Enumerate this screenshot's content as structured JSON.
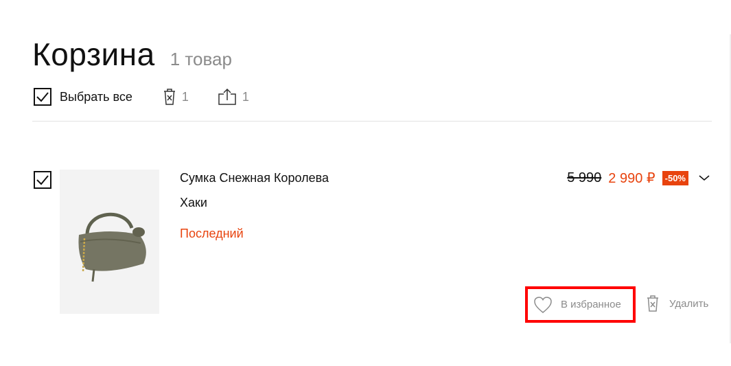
{
  "header": {
    "title": "Корзина",
    "count": "1 товар"
  },
  "toolbar": {
    "select_all_label": "Выбрать все",
    "delete_count": "1",
    "share_count": "1"
  },
  "item": {
    "name": "Сумка Снежная Королева",
    "color": "Хаки",
    "stock": "Последний",
    "old_price": "5 990",
    "new_price": "2 990 ₽",
    "discount": "-50%",
    "favorite_label": "В избранное",
    "delete_label": "Удалить"
  },
  "colors": {
    "accent": "#e8430e",
    "highlight": "#ff0000",
    "muted": "#8b8b8b"
  }
}
